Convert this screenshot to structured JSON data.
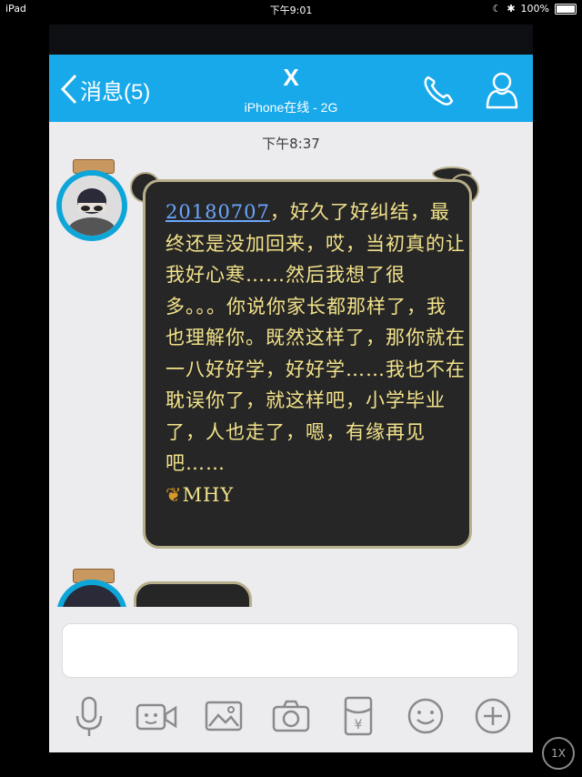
{
  "status_bar": {
    "device": "iPad",
    "time": "下午9:01",
    "battery": "100%"
  },
  "nav": {
    "back_label": "消息(5)",
    "title": "X",
    "subtitle": "iPhone在线 - 2G"
  },
  "chat": {
    "timestamp": "下午8:37",
    "message": {
      "link": "20180707",
      "text": "，好久了好纠结，最终还是没加回来，哎，当初真的让我好心寒……然后我想了很多。。。你说你家长都那样了，我也理解你。既然这样了，那你就在一八好好学，好好学……我也不在耽误你了，就这样吧，小学毕业了，人也走了，嗯，有缘再见吧……",
      "signature": "MHY"
    }
  },
  "toolbar": {
    "items": [
      "microphone",
      "video",
      "image",
      "camera",
      "red-packet",
      "emoji",
      "plus"
    ]
  },
  "overlay": {
    "zoom_label": "1X"
  }
}
